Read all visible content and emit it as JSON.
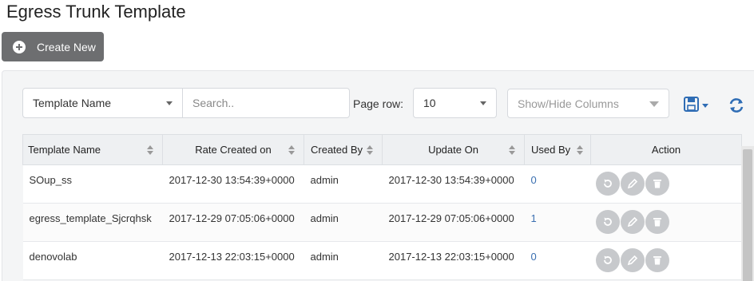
{
  "page": {
    "title": "Egress Trunk Template"
  },
  "toolbar": {
    "create_label": "Create New"
  },
  "filters": {
    "field_value": "Template Name",
    "search_placeholder": "Search..",
    "page_row_label": "Page row:",
    "page_row_value": "10",
    "columns_placeholder": "Show/Hide Columns"
  },
  "table": {
    "headers": [
      "Template Name",
      "Rate Created on",
      "Created By",
      "Update On",
      "Used By",
      "Action"
    ],
    "rows": [
      {
        "name": "SOup_ss",
        "created": "2017-12-30 13:54:39+0000",
        "by": "admin",
        "updated": "2017-12-30 13:54:39+0000",
        "used": "0"
      },
      {
        "name": "egress_template_Sjcrqhsk",
        "created": "2017-12-29 07:05:06+0000",
        "by": "admin",
        "updated": "2017-12-29 07:05:06+0000",
        "used": "1"
      },
      {
        "name": "denovolab",
        "created": "2017-12-13 22:03:15+0000",
        "by": "admin",
        "updated": "2017-12-13 22:03:15+0000",
        "used": "0"
      }
    ]
  },
  "colors": {
    "accent": "#2f6db5",
    "button_dark": "#6d6e70",
    "action_button": "#c7c9cc"
  },
  "icons": [
    "plus-circle-icon",
    "save-icon",
    "refresh-icon",
    "sort-icon",
    "reset-icon",
    "edit-icon",
    "delete-icon"
  ]
}
